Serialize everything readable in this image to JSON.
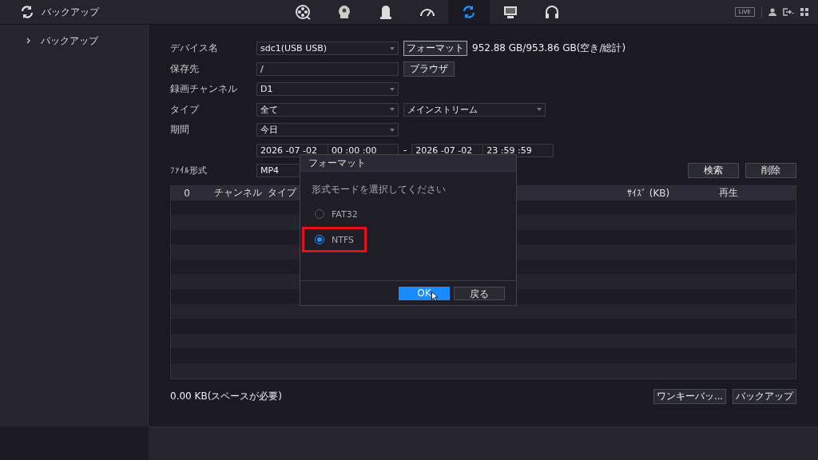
{
  "app_bar": {
    "title": "バックアップ",
    "nav": [
      {
        "selected": false
      },
      {
        "selected": false
      },
      {
        "selected": false
      },
      {
        "selected": false
      },
      {
        "selected": true
      },
      {
        "selected": false
      },
      {
        "selected": false
      }
    ],
    "live_badge": "LIVE"
  },
  "sidebar": {
    "items": [
      {
        "label": "バックアップ"
      }
    ]
  },
  "form": [
    {
      "label": "デバイス名",
      "controls": [
        {
          "kind": "select",
          "value": "sdc1(USB USB)"
        },
        {
          "kind": "button",
          "label": "フォーマット",
          "focused": true
        },
        {
          "kind": "text",
          "text": "952.88 GB/953.86 GB(空き/総計)"
        }
      ]
    },
    {
      "label": "保存先",
      "controls": [
        {
          "kind": "input",
          "value": "/"
        },
        {
          "kind": "button",
          "label": "ブラウザ",
          "focused": false
        }
      ]
    },
    {
      "label": "録画チャンネル",
      "controls": [
        {
          "kind": "select",
          "value": "D1"
        }
      ]
    },
    {
      "label": "タイプ",
      "controls": [
        {
          "kind": "select",
          "value": "全て"
        },
        {
          "kind": "select",
          "value": "メインストリーム"
        }
      ]
    },
    {
      "label": "期間",
      "controls": [
        {
          "kind": "select",
          "value": "今日"
        }
      ]
    },
    {
      "controls": [
        {
          "kind": "datetime",
          "date": "2026 -07 -02",
          "time": "00 :00 :00"
        },
        {
          "kind": "text",
          "text": "-"
        },
        {
          "kind": "datetime",
          "date": "2026 -07 -02",
          "time": "23 :59 :59"
        }
      ]
    }
  ],
  "file_format": {
    "label": "ﾌｧｲﾙ形式",
    "value": "MP4"
  },
  "search_actions": [
    "検索",
    "削除"
  ],
  "table": {
    "columns": [
      "0",
      "チャンネル",
      "タイプ",
      "ｻｲｽﾞ (KB)",
      "再生"
    ]
  },
  "footer": {
    "required_space": "0.00 KB(スペースが必要)",
    "buttons": [
      "ワンキーバッ...",
      "バックアップ"
    ]
  },
  "dialog": {
    "title": "フォーマット",
    "prompt": "形式モードを選択してください",
    "options": [
      {
        "label": "FAT32",
        "selected": false,
        "highlighted": false
      },
      {
        "label": "NTFS",
        "selected": true,
        "highlighted": true
      }
    ],
    "buttons": [
      {
        "label": "OK",
        "primary": true
      },
      {
        "label": "戻る",
        "primary": false
      }
    ]
  }
}
